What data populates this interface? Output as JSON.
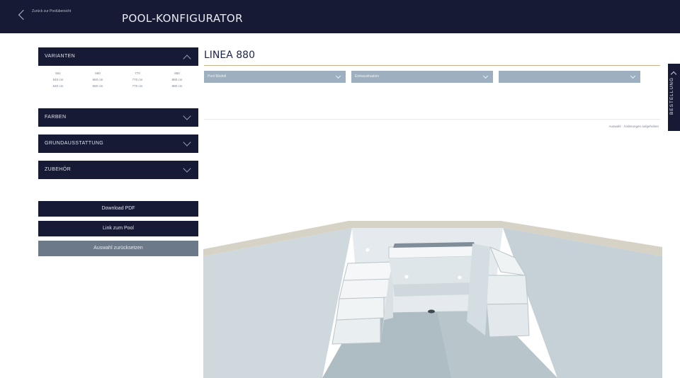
{
  "header": {
    "back_label": "Zurück zur Poolübersicht",
    "title": "POOL-KONFIGURATOR"
  },
  "sidebar": {
    "sections": [
      {
        "label": "VARIANTEN",
        "expanded": true
      },
      {
        "label": "FARBEN",
        "expanded": false
      },
      {
        "label": "GRUNDAUSSTATTUNG",
        "expanded": false
      },
      {
        "label": "ZUBEHÖR",
        "expanded": false
      }
    ],
    "variants": [
      {
        "name": "551",
        "line2": "540 cm",
        "line3": "540 cm"
      },
      {
        "name": "660",
        "line2": "660 cm",
        "line3": "660 cm"
      },
      {
        "name": "770",
        "line2": "770 cm",
        "line3": "770 cm"
      },
      {
        "name": "880",
        "line2": "880 cm",
        "line3": "880 cm"
      }
    ],
    "buttons": {
      "download": "Download PDF",
      "link": "Link zum Pool",
      "reset": "Auswahl zurücksetzen"
    }
  },
  "main": {
    "title": "LINEA 880",
    "dropdowns": [
      {
        "value": "Pool Modell"
      },
      {
        "value": "Einbausituation"
      },
      {
        "value": ""
      }
    ],
    "reset_link": "Auswahl · Änderungen aufgehoben",
    "side_tab": "BESTELLUNG"
  },
  "colors": {
    "navy": "#161a34",
    "dropdown": "#9eafbf",
    "reset_button": "#6b7989",
    "accent_line": "#c9b28a",
    "pool_wall": "#dfe6ea",
    "pool_floor": "#aebdc4"
  }
}
